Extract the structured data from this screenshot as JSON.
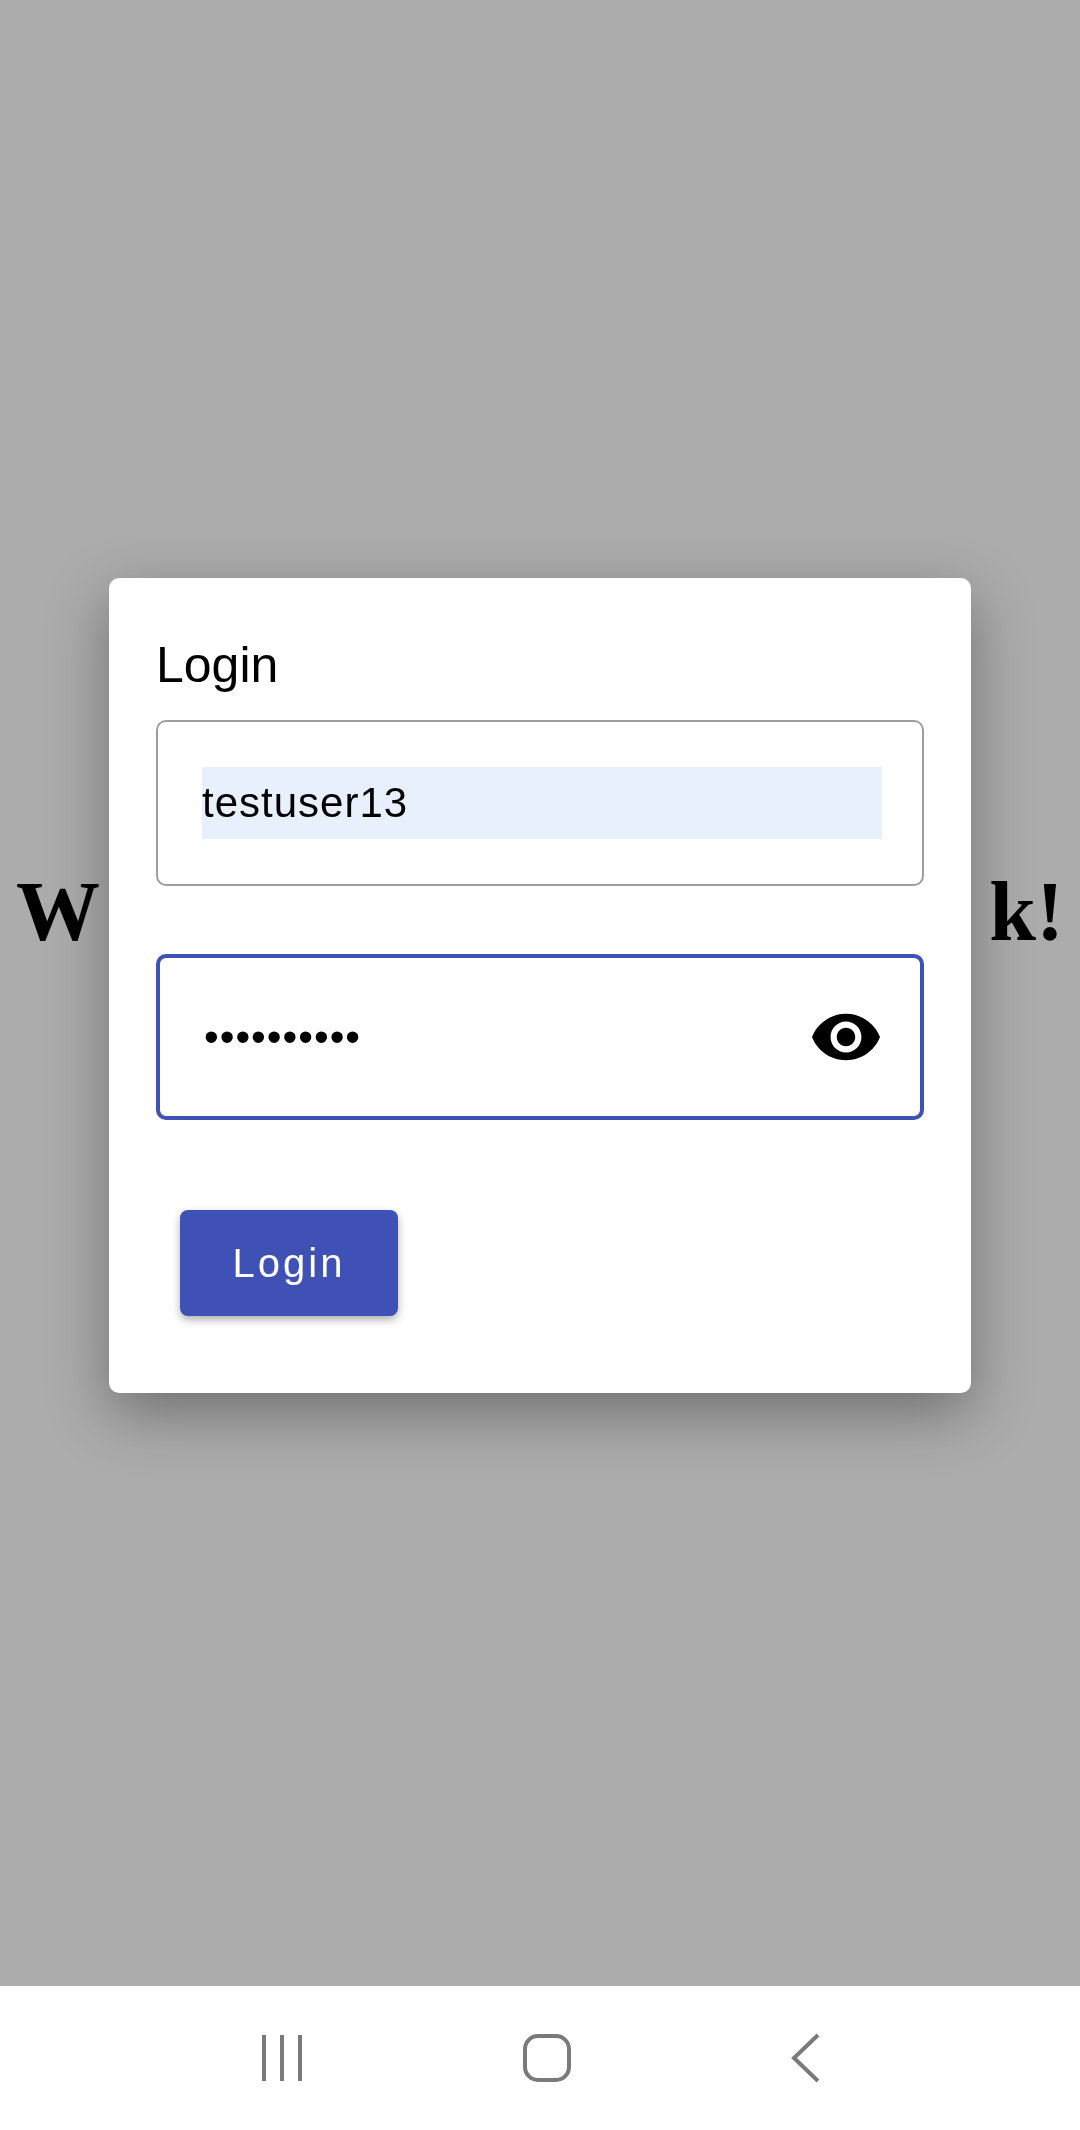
{
  "background": {
    "heading_left": "W",
    "heading_right": "k!"
  },
  "dialog": {
    "title": "Login",
    "username": {
      "value": "testuser13",
      "autofilled": true,
      "focused": false
    },
    "password": {
      "value": "••••••••••",
      "autofilled": false,
      "focused": true
    },
    "button": "Login"
  }
}
